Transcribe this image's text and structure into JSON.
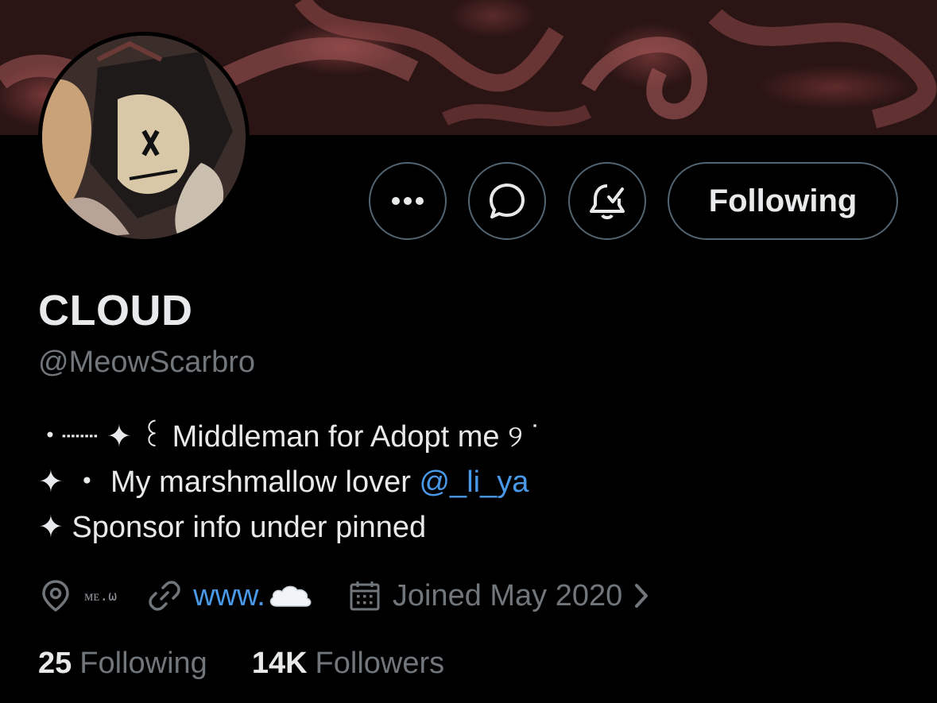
{
  "profile": {
    "name": "CLOUD",
    "handle": "@MeowScarbro",
    "bio_line1": "・┈┈ ✦ ꒰ Middleman for Adopt me ୨ ˙",
    "bio_line2_text": "✦ ・ My marshmallow lover ",
    "bio_line2_mention": "@_li_ya",
    "bio_line3": "✦ Sponsor info under pinned",
    "location": "ᴍᴇ.ω",
    "website": "www.",
    "website_emoji": "☁️",
    "joined": "Joined May 2020"
  },
  "actions": {
    "follow_label": "Following",
    "more_icon": "more-icon",
    "message_icon": "message-icon",
    "notify_icon": "notification-bell-icon"
  },
  "stats": {
    "following_count": "25",
    "following_label": "Following",
    "followers_count": "14K",
    "followers_label": "Followers"
  },
  "colors": {
    "background": "#000000",
    "text": "#e7e9ea",
    "secondary": "#71767b",
    "link": "#4a99e9",
    "border": "#536471"
  }
}
